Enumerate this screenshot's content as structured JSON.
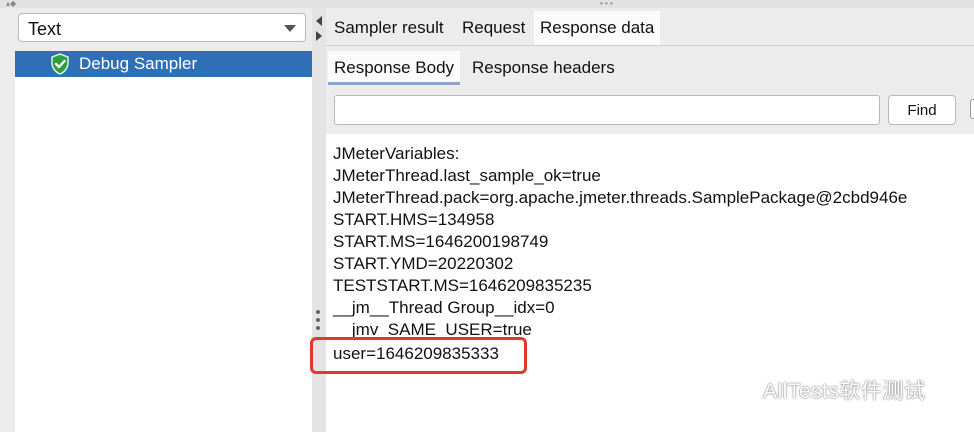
{
  "left_panel": {
    "render_select": {
      "value": "Text"
    },
    "tree": {
      "items": [
        {
          "label": "Debug Sampler",
          "selected": true,
          "icon": "green-shield-check-icon"
        }
      ]
    }
  },
  "right_panel": {
    "main_tabs": [
      {
        "label": "Sampler result"
      },
      {
        "label": "Request"
      },
      {
        "label": "Response data",
        "active": true
      }
    ],
    "sub_tabs": [
      {
        "label": "Response Body",
        "active": true
      },
      {
        "label": "Response headers"
      }
    ],
    "search": {
      "value": "",
      "find_label": "Find"
    },
    "response_lines": [
      "JMeterVariables:",
      "JMeterThread.last_sample_ok=true",
      "JMeterThread.pack=org.apache.jmeter.threads.SamplePackage@2cbd946e",
      "START.HMS=134958",
      "START.MS=1646200198749",
      "START.YMD=20220302",
      "TESTSTART.MS=1646209835235",
      "__jm__Thread Group__idx=0",
      "__jmv_SAME_USER=true",
      "user=1646209835333"
    ]
  },
  "watermark": {
    "text": "AllTests软件测试",
    "icon": "wechat-icon"
  },
  "colors": {
    "selection": "#2f6fb5",
    "highlight_border": "#e03a2e"
  }
}
